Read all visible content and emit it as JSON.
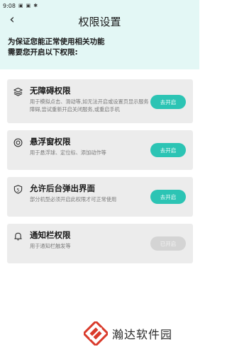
{
  "status_bar": {
    "time": "9:08",
    "icons": [
      "notification-icon",
      "notification-icon",
      "bug-icon"
    ]
  },
  "header": {
    "back_icon": "‹",
    "title": "权限设置"
  },
  "intro": {
    "line1": "为保证您能正常使用相关功能",
    "line2": "需要您开启以下权限:"
  },
  "permissions": [
    {
      "icon": "layers-icon",
      "title": "无障碍权限",
      "description": "用于模拟点击、滑动等,如无法开启或设置页显示服务障碍,尝试重新开启关闭服务,或重启手机",
      "button": "去开启",
      "enabled": true
    },
    {
      "icon": "float-window-icon",
      "title": "悬浮窗权限",
      "description": "用于悬浮球、定位标、添加动作等",
      "button": "去开启",
      "enabled": true
    },
    {
      "icon": "shield-icon",
      "title": "允许后台弹出界面",
      "description": "部分机型必须开启此权限才可正常使用",
      "button": "去开启",
      "enabled": true
    },
    {
      "icon": "bell-icon",
      "title": "通知栏权限",
      "description": "用于通知栏触发等",
      "button": "已开启",
      "enabled": false
    }
  ],
  "watermark": {
    "text": "瀚达软件园"
  },
  "colors": {
    "accent": "#2cc4b4",
    "header_bg": "#e3f7f5",
    "card_bg": "#ececec",
    "disabled_button": "#d4d4d4"
  }
}
